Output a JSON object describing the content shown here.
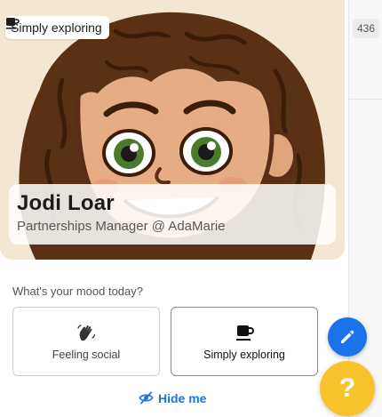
{
  "sidebar": {
    "count_badge": "436"
  },
  "profile": {
    "status_chip": {
      "label": "Simply exploring",
      "icon": "coffee-cup-icon"
    },
    "name": "Jodi Loar",
    "role": "Partnerships Manager @ AdaMarie",
    "avatar": {
      "icon": "cartoon-avatar",
      "background": "#f3e6d2",
      "hair_color": "#5a3213",
      "eye_color": "#4c7a2c"
    }
  },
  "mood": {
    "question": "What's your mood today?",
    "options": [
      {
        "label": "Feeling social",
        "icon": "waving-hand-icon",
        "selected": false
      },
      {
        "label": "Simply exploring",
        "icon": "coffee-cup-icon",
        "selected": true
      }
    ]
  },
  "hide_link": {
    "label": "Hide me",
    "icon": "eye-slash-icon",
    "color": "#1f74d6"
  },
  "fabs": {
    "edit": {
      "icon": "pencil-icon",
      "color": "#1a73e8"
    },
    "help": {
      "label": "?",
      "color": "#f8c22c"
    }
  }
}
